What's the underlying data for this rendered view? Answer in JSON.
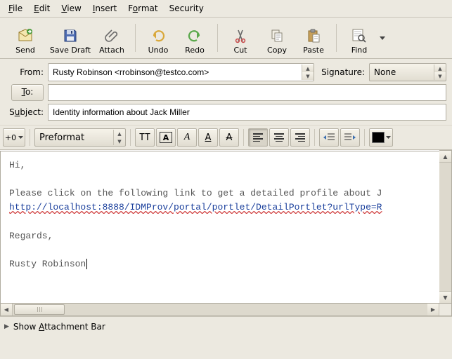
{
  "menu": {
    "file": "ile",
    "edit": "dit",
    "view": "iew",
    "insert": "nsert",
    "format": "at",
    "security": "ecurity"
  },
  "tb": {
    "send": "Send",
    "savedraft": "Save Draft",
    "attach": "Attach",
    "undo": "Undo",
    "redo": "Redo",
    "cut": "Cut",
    "copy": "Copy",
    "paste": "Paste",
    "find": "Find"
  },
  "hdr": {
    "from_label": "From:",
    "from_value": "Rusty Robinson <rrobinson@testco.com>",
    "sig_label": "Signature:",
    "sig_value": "None",
    "to_label": "To:",
    "to_value": "",
    "subject_label": "Subject:",
    "subject_value": "Identity information about Jack Miller"
  },
  "fmt": {
    "bigger": "+0",
    "style": "Preformat"
  },
  "body": {
    "greeting": "Hi,",
    "para": "Please click on the following link to get a detailed profile about J",
    "url": "http://localhost:8888/IDMProv/portal/portlet/DetailPortlet?urlType=R",
    "regards": "Regards,",
    "sig": "Rusty Robinson"
  },
  "footer": {
    "attach": "Show Attachment Bar"
  }
}
